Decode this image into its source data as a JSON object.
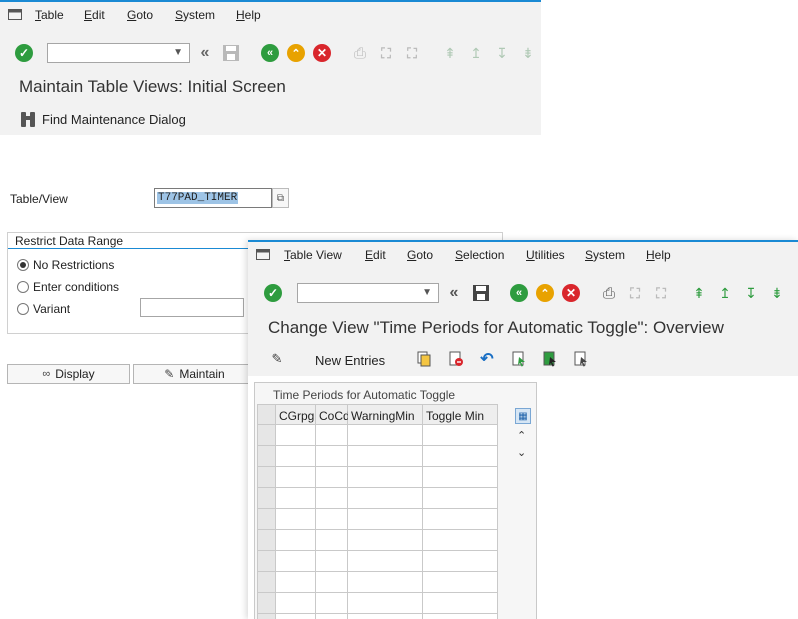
{
  "bg_window": {
    "menu": [
      "Table",
      "Edit",
      "Goto",
      "System",
      "Help"
    ],
    "title": "Maintain Table Views: Initial Screen",
    "find_dialog_label": "Find Maintenance Dialog",
    "table_view_label": "Table/View",
    "table_view_value": "T77PAD_TIMER",
    "restrict_title": "Restrict Data Range",
    "options": [
      "No Restrictions",
      "Enter conditions",
      "Variant"
    ],
    "display_button": "Display",
    "maintain_button": "Maintain"
  },
  "fg_window": {
    "menu": [
      "Table View",
      "Edit",
      "Goto",
      "Selection",
      "Utilities",
      "System",
      "Help"
    ],
    "title": "Change View \"Time Periods for Automatic Toggle\": Overview",
    "new_entries": "New Entries",
    "table_title": "Time Periods for Automatic Toggle",
    "columns": [
      "CGrpg",
      "CoCd",
      "WarningMin",
      "Toggle Min"
    ]
  },
  "colors": {
    "accent": "#1a8ad4",
    "green": "#2e9c3f",
    "orange": "#e8a200",
    "red": "#d9262c"
  }
}
